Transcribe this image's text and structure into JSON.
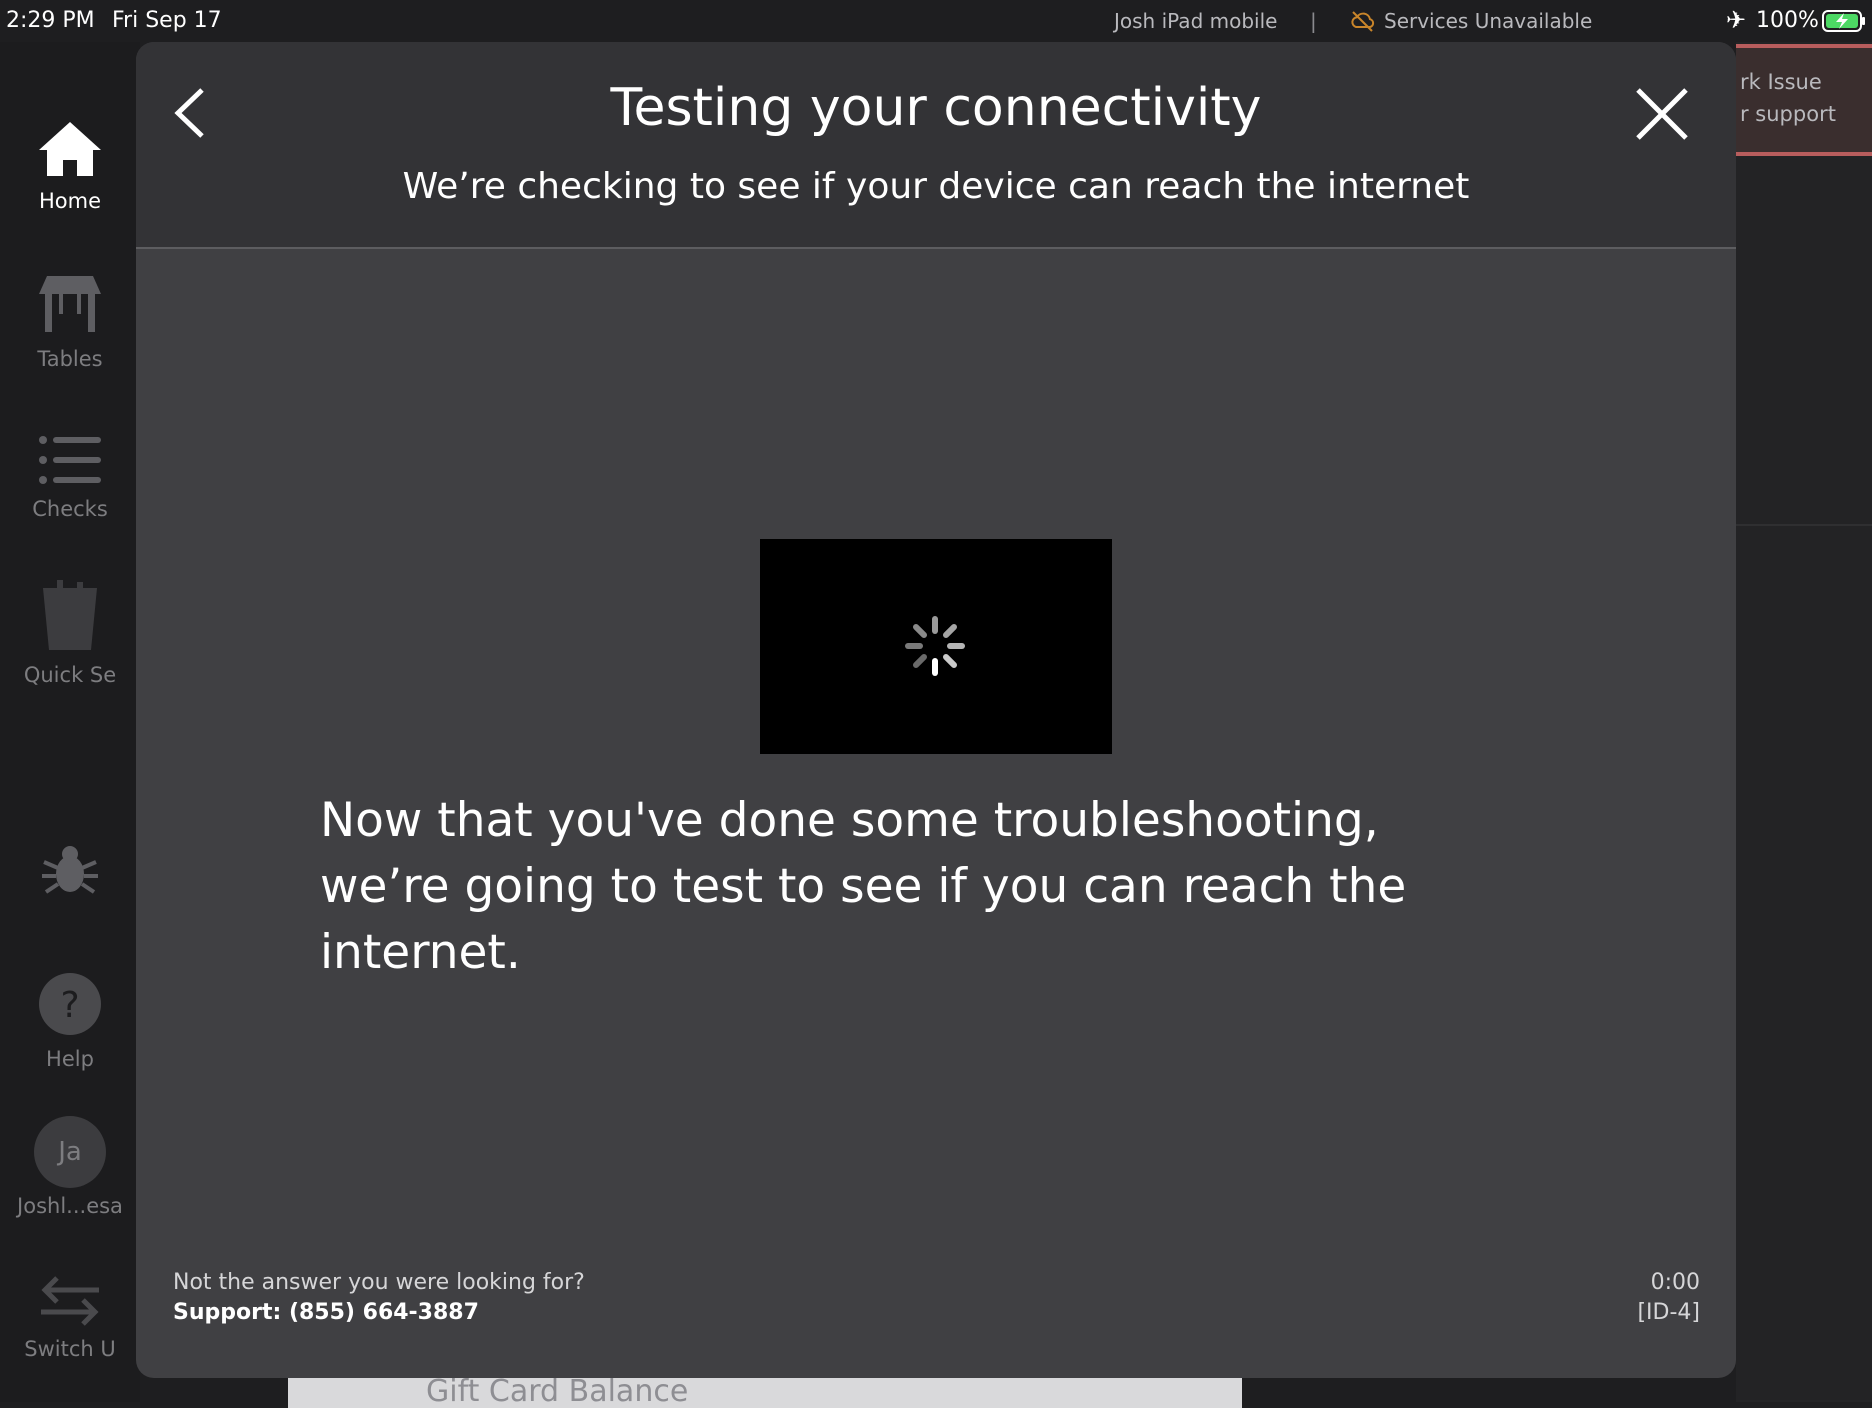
{
  "status_bar": {
    "time": "2:29 PM",
    "date": "Fri Sep 17",
    "device": "Josh iPad mobile",
    "separator": "|",
    "service_status": "Services Unavailable",
    "battery": "100%"
  },
  "sidebar": {
    "items": [
      {
        "label": "Home",
        "icon": "home-icon"
      },
      {
        "label": "Tables",
        "icon": "table-icon"
      },
      {
        "label": "Checks",
        "icon": "list-icon"
      },
      {
        "label": "Quick Se",
        "icon": "quick-service-icon"
      },
      {
        "label": "",
        "icon": "bug-icon"
      },
      {
        "label": "Help",
        "icon": "help-icon"
      },
      {
        "label": "Joshl...esa",
        "icon": "avatar",
        "initials": "Ja"
      },
      {
        "label": "Switch U",
        "icon": "switch-user-icon"
      }
    ]
  },
  "right_banner": {
    "line1": "rk Issue",
    "line2": "r support"
  },
  "background_card": {
    "label": "Gift Card Balance"
  },
  "modal": {
    "title": "Testing your connectivity",
    "subtitle": "We’re checking to see if your device can reach the internet",
    "message": "Now that you've done some troubleshooting, we’re going to test to see if you can reach the internet.",
    "footer": {
      "question": "Not the answer you were looking for?",
      "support": "Support: (855) 664-3887",
      "timer": "0:00",
      "id": "[ID-4]"
    }
  },
  "colors": {
    "modal_bg": "#404043",
    "header_bg": "#333336",
    "banner_accent": "#b85d5d",
    "service_warning": "#c9852a",
    "battery_green": "#4cd964"
  }
}
